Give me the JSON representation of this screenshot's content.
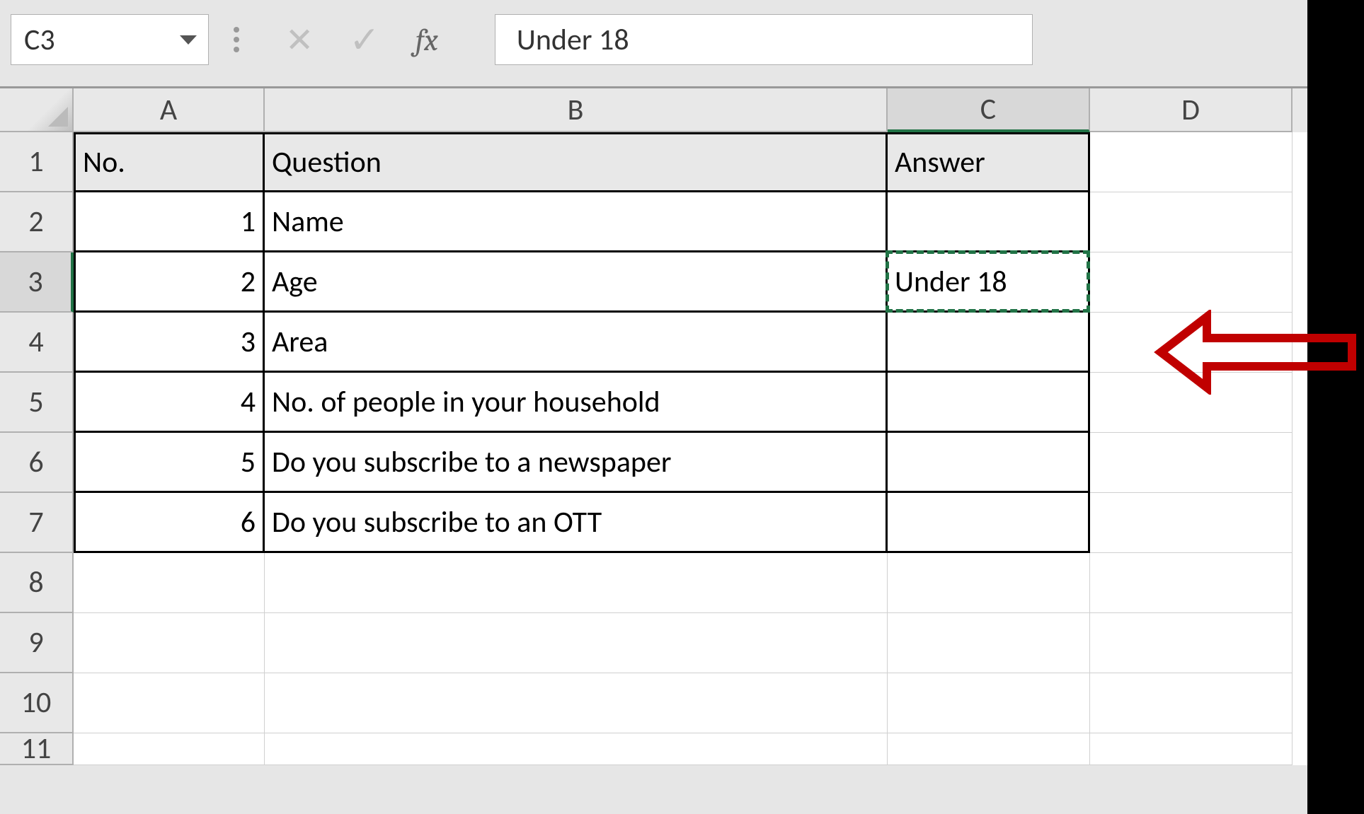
{
  "formula_bar": {
    "cell_reference": "C3",
    "fx_label": "fx",
    "formula_value": "Under 18"
  },
  "columns": [
    "A",
    "B",
    "C",
    "D"
  ],
  "rows": [
    "1",
    "2",
    "3",
    "4",
    "5",
    "6",
    "7",
    "8",
    "9",
    "10",
    "11"
  ],
  "active_cell": "C3",
  "table": {
    "headers": {
      "no": "No.",
      "question": "Question",
      "answer": "Answer"
    },
    "data": [
      {
        "no": "1",
        "question": "Name",
        "answer": ""
      },
      {
        "no": "2",
        "question": "Age",
        "answer": "Under 18"
      },
      {
        "no": "3",
        "question": "Area",
        "answer": ""
      },
      {
        "no": "4",
        "question": "No. of people in your household",
        "answer": ""
      },
      {
        "no": "5",
        "question": "Do you subscribe to a newspaper",
        "answer": ""
      },
      {
        "no": "6",
        "question": "Do you subscribe to an OTT",
        "answer": ""
      }
    ]
  }
}
